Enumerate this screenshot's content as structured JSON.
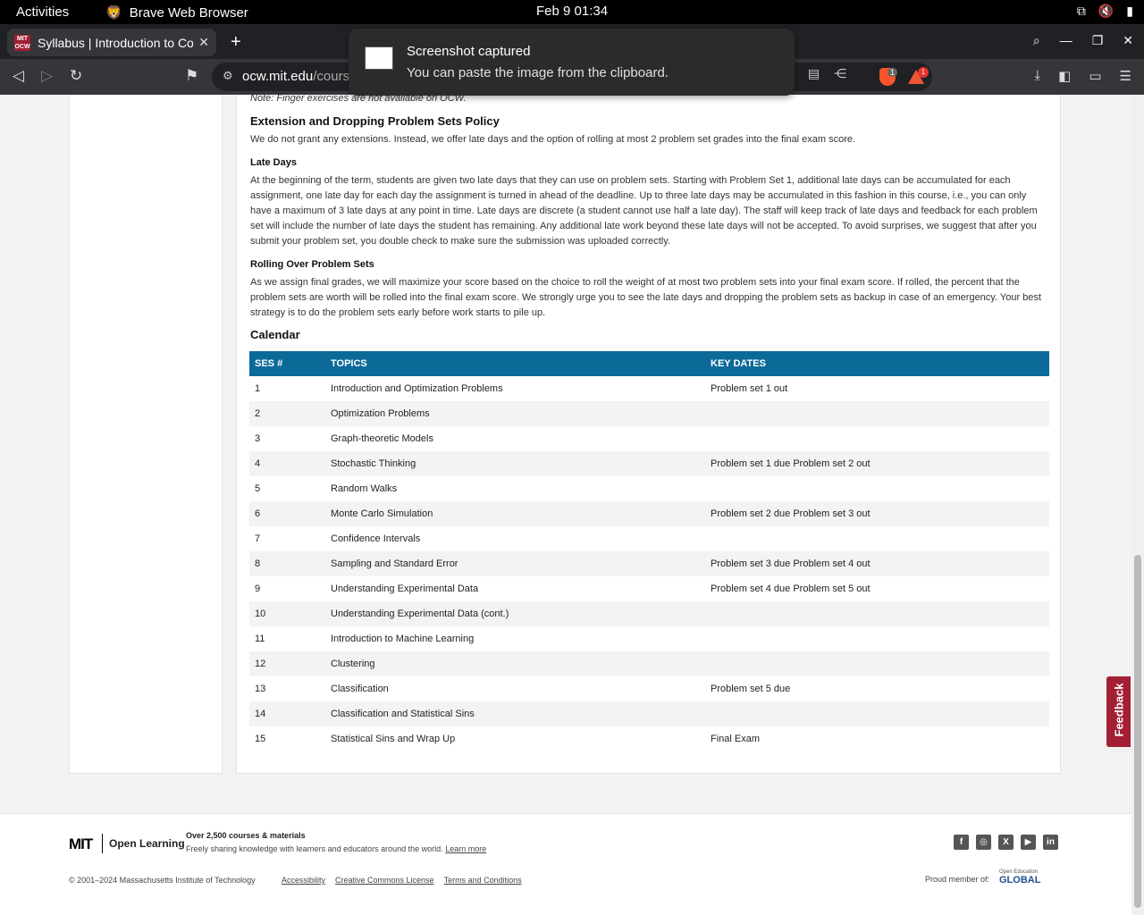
{
  "system": {
    "activities": "Activities",
    "app_name": "Brave Web Browser",
    "clock": "Feb 9  01:34"
  },
  "browser": {
    "tab_title": "Syllabus | Introduction to Computational Thinking and Data Science",
    "favicon_text": "MIT OCW",
    "url_host": "ocw.mit.edu",
    "url_path": "/course",
    "shields_badge": "1",
    "rewards_badge": "1"
  },
  "notification": {
    "title": "Screenshot captured",
    "body": "You can paste the image from the clipboard."
  },
  "content": {
    "note": "Note: Finger exercises are not available on OCW.",
    "extension_heading": "Extension and Dropping Problem Sets Policy",
    "extension_text": "We do not grant any extensions. Instead, we offer late days and the option of rolling at most 2 problem set grades into the final exam score.",
    "late_days_heading": "Late Days",
    "late_days_text": "At the beginning of the term, students are given two late days that they can use on problem sets. Starting with Problem Set 1, additional late days can be accumulated for each assignment, one late day for each day the assignment is turned in ahead of the deadline. Up to three late days may be accumulated in this fashion in this course, i.e., you can only have a maximum of 3 late days at any point in time. Late days are discrete (a student cannot use half a late day). The staff will keep track of late days and feedback for each problem set will include the number of late days the student has remaining. Any additional late work beyond these late days will not be accepted. To avoid surprises, we suggest that after you submit your problem set, you double check to make sure the submission was uploaded correctly.",
    "rolling_heading": "Rolling Over Problem Sets",
    "rolling_text": "As we assign final grades, we will maximize your score based on the choice to roll the weight of at most two problem sets into your final exam score. If rolled, the percent that the problem sets are worth will be rolled into the final exam score. We strongly urge you to see the late days and dropping the problem sets as backup in case of an emergency. Your best strategy is to do the problem sets early before work starts to pile up.",
    "calendar_heading": "Calendar"
  },
  "calendar": {
    "headers": [
      "SES #",
      "TOPICS",
      "KEY DATES"
    ],
    "rows": [
      [
        "1",
        "Introduction and Optimization Problems",
        "Problem set 1 out"
      ],
      [
        "2",
        "Optimization Problems",
        ""
      ],
      [
        "3",
        "Graph-theoretic Models",
        ""
      ],
      [
        "4",
        "Stochastic Thinking",
        "Problem set 1 due Problem set 2 out"
      ],
      [
        "5",
        "Random Walks",
        ""
      ],
      [
        "6",
        "Monte Carlo Simulation",
        "Problem set 2 due Problem set 3 out"
      ],
      [
        "7",
        "Confidence Intervals",
        ""
      ],
      [
        "8",
        "Sampling and Standard Error",
        "Problem set 3 due Problem set 4 out"
      ],
      [
        "9",
        "Understanding Experimental Data",
        "Problem set 4 due Problem set 5 out"
      ],
      [
        "10",
        "Understanding Experimental Data (cont.)",
        ""
      ],
      [
        "11",
        "Introduction to Machine Learning",
        ""
      ],
      [
        "12",
        "Clustering",
        ""
      ],
      [
        "13",
        "Classification",
        "Problem set 5 due"
      ],
      [
        "14",
        "Classification and Statistical Sins",
        ""
      ],
      [
        "15",
        "Statistical Sins and Wrap Up",
        "Final Exam"
      ]
    ]
  },
  "feedback_label": "Feedback",
  "footer": {
    "mit_logo": "MIT",
    "ol_logo": "Open Learning",
    "tagline_bold": "Over 2,500 courses & materials",
    "tagline": "Freely sharing knowledge with learners and educators around the world.",
    "learn_more": "Learn more",
    "copyright": "© 2001–2024 Massachusetts Institute of Technology",
    "links": [
      "Accessibility",
      "Creative Commons License",
      "Terms and Conditions"
    ],
    "proud_member": "Proud member of:",
    "oeg_small": "Open Education",
    "oeg_big": "GLOBAL"
  }
}
